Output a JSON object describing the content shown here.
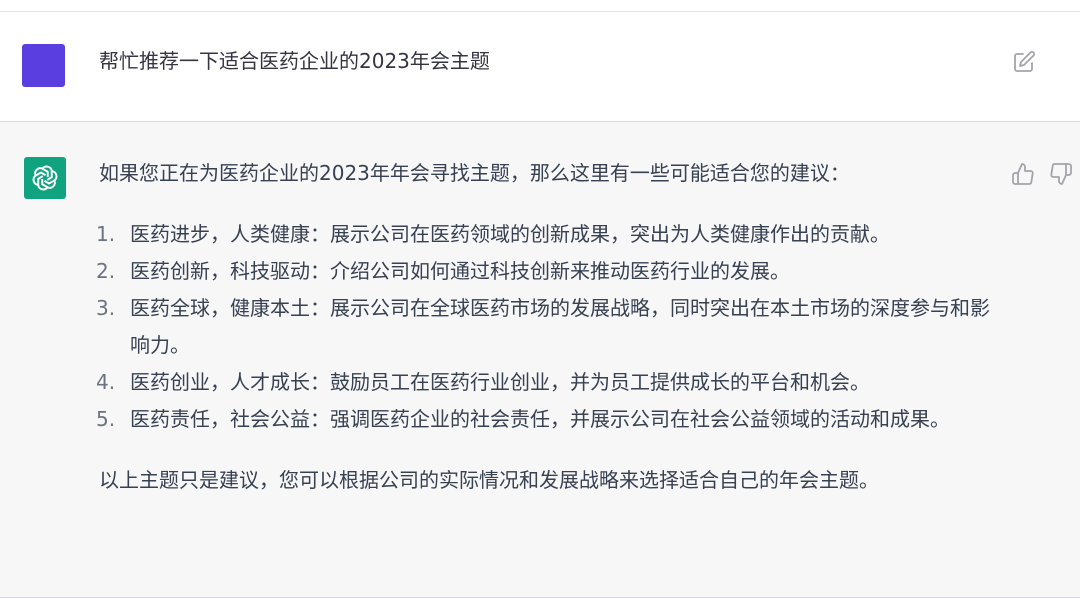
{
  "conversation": {
    "user": {
      "avatar_color": "#5b3ee0",
      "message": "帮忙推荐一下适合医药企业的2023年会主题"
    },
    "assistant": {
      "avatar_color": "#10a37f",
      "intro": "如果您正在为医药企业的2023年年会寻找主题，那么这里有一些可能适合您的建议：",
      "points": [
        {
          "num": "1.",
          "text": "医药进步，人类健康：展示公司在医药领域的创新成果，突出为人类健康作出的贡献。"
        },
        {
          "num": "2.",
          "text": "医药创新，科技驱动：介绍公司如何通过科技创新来推动医药行业的发展。"
        },
        {
          "num": "3.",
          "text": "医药全球，健康本土：展示公司在全球医药市场的发展战略，同时突出在本土市场的深度参与和影响力。"
        },
        {
          "num": "4.",
          "text": "医药创业，人才成长：鼓励员工在医药行业创业，并为员工提供成长的平台和机会。"
        },
        {
          "num": "5.",
          "text": "医药责任，社会公益：强调医药企业的社会责任，并展示公司在社会公益领域的活动和成果。"
        }
      ],
      "outro": "以上主题只是建议，您可以根据公司的实际情况和发展战略来选择适合自己的年会主题。"
    }
  },
  "icons": {
    "edit": "edit-icon",
    "thumbs_up": "thumbs-up-icon",
    "thumbs_down": "thumbs-down-icon",
    "logo": "openai-logo-icon"
  }
}
